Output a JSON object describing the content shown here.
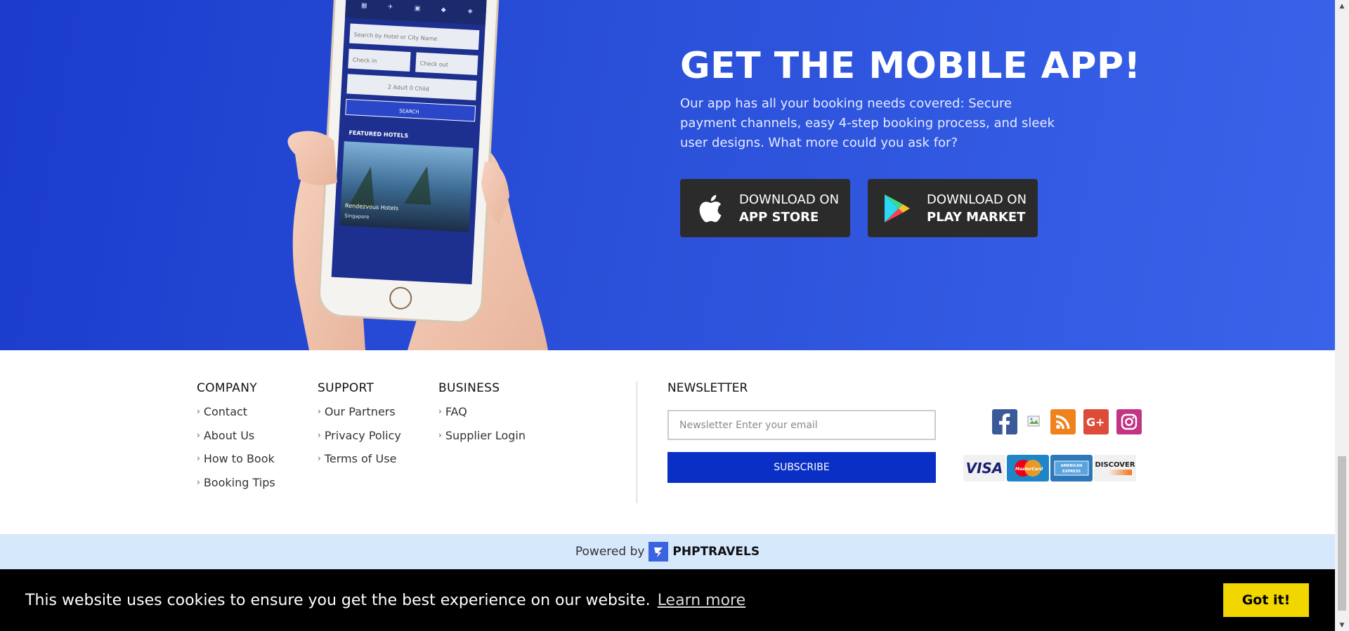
{
  "hero": {
    "title": "GET THE MOBILE APP!",
    "description": "Our app has all your booking needs covered: Secure payment channels, easy 4-step booking process, and sleek user designs. What more could you ask for?",
    "phone_screen": {
      "search_placeholder": "Search by Hotel or City Name",
      "check_in": "Check in",
      "check_out": "Check out",
      "guests": "2 Adult 0 Child",
      "search_label": "SEARCH",
      "featured_label": "FEATURED HOTELS",
      "hotel_name": "Rendezvous Hotels",
      "hotel_city": "Singapore"
    },
    "app_store": {
      "line1": "DOWNLOAD ON",
      "line2": "APP STORE",
      "icon": "apple-icon"
    },
    "play_market": {
      "line1": "DOWNLOAD ON",
      "line2": "PLAY MARKET",
      "icon": "google-play-icon"
    }
  },
  "footer": {
    "company": {
      "title": "COMPANY",
      "links": [
        "Contact",
        "About Us",
        "How to Book",
        "Booking Tips"
      ]
    },
    "support": {
      "title": "SUPPORT",
      "links": [
        "Our Partners",
        "Privacy Policy",
        "Terms of Use"
      ]
    },
    "business": {
      "title": "BUSINESS",
      "links": [
        "FAQ",
        "Supplier Login"
      ]
    },
    "newsletter": {
      "title": "NEWSLETTER",
      "placeholder": "Newsletter Enter your email",
      "subscribe_label": "SUBSCRIBE"
    },
    "social": [
      "facebook-icon",
      "twitter-broken-image-icon",
      "rss-icon",
      "google-plus-icon",
      "instagram-icon"
    ],
    "payments": [
      {
        "name": "visa-card",
        "label": "VISA",
        "color": "#1a1f71"
      },
      {
        "name": "mastercard-card",
        "label": "MasterCard",
        "color": "#eb001b"
      },
      {
        "name": "american-express-card",
        "label": "AMERICAN EXPRESS",
        "color": "#2e77bb"
      },
      {
        "name": "discover-card",
        "label": "DISCOVER",
        "color": "#f47216"
      }
    ]
  },
  "powered": {
    "prefix": "Powered by",
    "brand": "PHPTRAVELS"
  },
  "cookie": {
    "message": "This website uses cookies to ensure you get the best experience on our website.",
    "learn_more": "Learn more",
    "accept_label": "Got it!"
  },
  "colors": {
    "hero_gradient_start": "#1b3ccc",
    "hero_gradient_end": "#3a63ea",
    "subscribe": "#0a2fc4",
    "powered_bg": "#d6e8fc",
    "cookie_btn": "#f1d600"
  }
}
